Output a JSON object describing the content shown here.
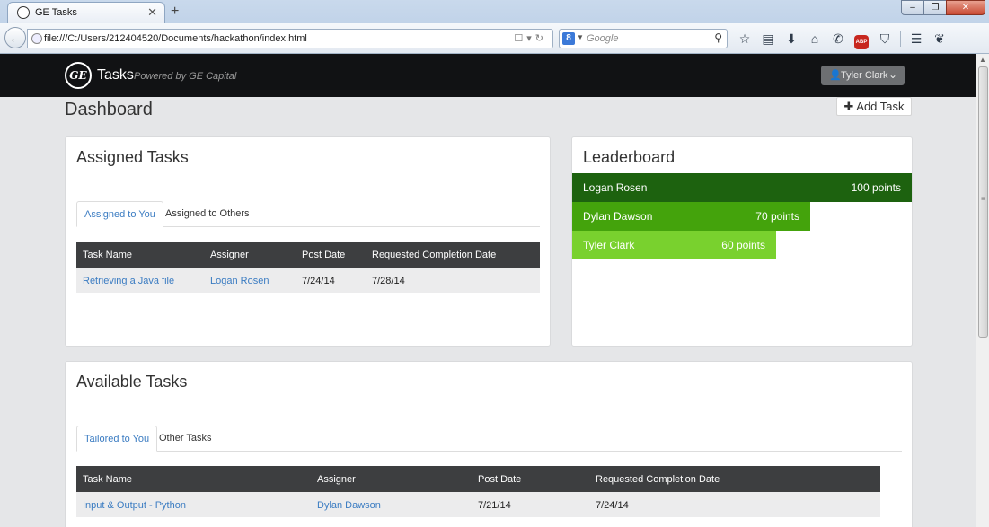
{
  "browser": {
    "tab_title": "GE Tasks",
    "tab_close": "✕",
    "new_tab": "+",
    "url": "file:///C:/Users/212404520/Documents/hackathon/index.html",
    "search_placeholder": "Google",
    "search_engine_badge": "8",
    "window_buttons": {
      "minimize": "‒",
      "maximize": "❐",
      "close": "✕"
    },
    "toolbar_icons": [
      "star-icon",
      "reading-list-icon",
      "download-icon",
      "home-icon",
      "phone-icon",
      "adblock-icon",
      "pocket-icon",
      "menu-icon",
      "firebug-icon"
    ],
    "adblock_label": "ABP"
  },
  "header": {
    "logo_text": "GE",
    "title": "Tasks",
    "subtitle": "Powered by GE Capital",
    "user_name": "Tyler Clark"
  },
  "dashboard": {
    "title": "Dashboard",
    "add_task_label": "Add Task"
  },
  "assigned": {
    "title": "Assigned Tasks",
    "tabs": [
      "Assigned to You",
      "Assigned to Others"
    ],
    "active_tab": 0,
    "columns": [
      "Task Name",
      "Assigner",
      "Post Date",
      "Requested Completion Date"
    ],
    "rows": [
      {
        "task": "Retrieving a Java file",
        "assigner": "Logan Rosen",
        "post_date": "7/24/14",
        "completion": "7/28/14"
      }
    ]
  },
  "leaderboard": {
    "title": "Leaderboard",
    "max_points": 100,
    "entries": [
      {
        "name": "Logan Rosen",
        "points_label": "100 points",
        "points": 100,
        "color": "#1d620f"
      },
      {
        "name": "Dylan Dawson",
        "points_label": "70 points",
        "points": 70,
        "color": "#44a30c"
      },
      {
        "name": "Tyler Clark",
        "points_label": "60 points",
        "points": 60,
        "color": "#79d12e"
      }
    ]
  },
  "available": {
    "title": "Available Tasks",
    "tabs": [
      "Tailored to You",
      "Other Tasks"
    ],
    "active_tab": 0,
    "columns": [
      "Task Name",
      "Assigner",
      "Post Date",
      "Requested Completion Date"
    ],
    "rows": [
      {
        "task": "Input & Output - Python",
        "assigner": "Dylan Dawson",
        "post_date": "7/21/14",
        "completion": "7/24/14"
      }
    ]
  },
  "colors": {
    "link": "#3b7cc2",
    "header_bg": "#111214",
    "table_head_bg": "#3d3e40"
  }
}
